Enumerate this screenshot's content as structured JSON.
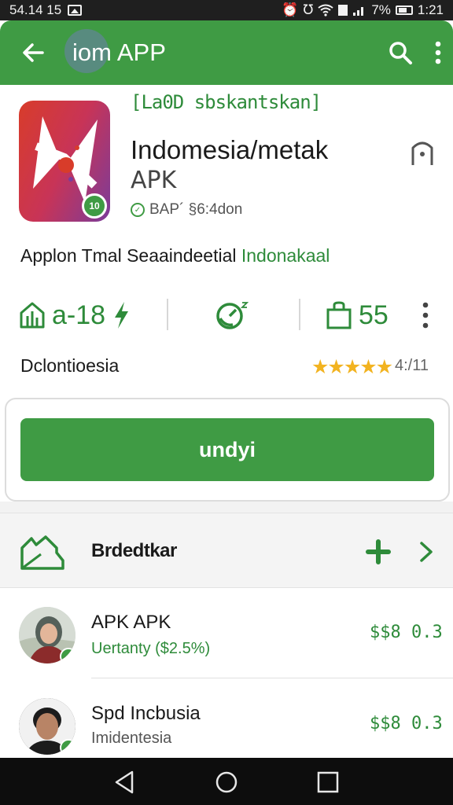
{
  "status_bar": {
    "time_left": "54.14 15",
    "battery_percent": "7%",
    "clock": "1:21"
  },
  "app_bar": {
    "title": "iom APP"
  },
  "app": {
    "top_text": "[La0D sbskantskan]",
    "name_line1": "Indomesia/metak",
    "name_line2": "APK",
    "developer": "BAP´ §6:4don",
    "description": "Applon Tmal Seaaindeetial",
    "description_accent": "Indonakaal",
    "icon_badge": "10"
  },
  "stats": {
    "age_value": "a-18",
    "size_value": "55"
  },
  "rating": {
    "label": "Dclontioesia",
    "stars": "★★★★★",
    "value": 4.5,
    "count": "4:/11"
  },
  "install": {
    "button_label": "undyi"
  },
  "section": {
    "title": "Brdedtkar"
  },
  "list": [
    {
      "title": "APK  APK",
      "subtitle": "Uertanty ($2.5%)",
      "price": "$$8 0.3"
    },
    {
      "title": "Spd Incbusia",
      "subtitle": "Imidentesia",
      "price": "$$8 0.3"
    }
  ],
  "colors": {
    "brand_green": "#3f9b44",
    "accent_text_green": "#2e8b3a",
    "star_color": "#f2b320",
    "status_bar": "#1f1f1f",
    "nav_bar": "#0d0d0d"
  }
}
